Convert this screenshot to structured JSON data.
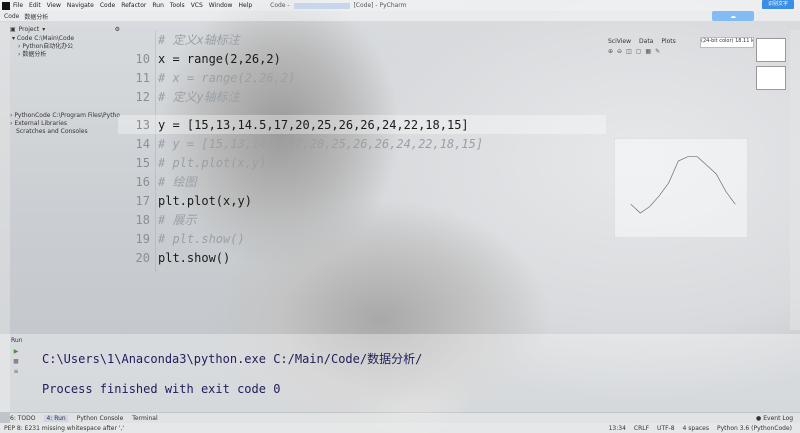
{
  "menu": {
    "items": [
      "File",
      "Edit",
      "View",
      "Navigate",
      "Code",
      "Refactor",
      "Run",
      "Tools",
      "VCS",
      "Window",
      "Help"
    ],
    "title_prefix": "Code -",
    "title_suffix": "[Code] - PyCharm"
  },
  "cloud_button": "识别文字",
  "breadcrumb": [
    "Code",
    "数据分析"
  ],
  "project": {
    "header": "Project",
    "tree": [
      {
        "label": "Code  C:\\Main\\Code"
      },
      {
        "label": "Python自动化办公"
      },
      {
        "label": "数据分析"
      }
    ],
    "tree2": [
      {
        "label": "PythonCode  C:\\Program Files\\Pytho"
      },
      {
        "label": "External Libraries"
      },
      {
        "label": "Scratches and Consoles"
      }
    ]
  },
  "editor": {
    "lines": [
      {
        "n": "",
        "text": "# 定义x轴标注",
        "type": "comment"
      },
      {
        "n": "10",
        "text": "x = range(2,26,2)",
        "type": "code"
      },
      {
        "n": "11",
        "text": "# x = range(2,26,2)",
        "type": "comment"
      },
      {
        "n": "12",
        "text": "# 定义y轴标注",
        "type": "comment"
      },
      {
        "n": "13",
        "text": "y = [15,13,14.5,17,20,25,26,26,24,22,18,15]",
        "type": "code"
      },
      {
        "n": "14",
        "text": "# y = [15,13,14.5,17,20,25,26,26,24,22,18,15]",
        "type": "comment"
      },
      {
        "n": "15",
        "text": "# plt.plot(x,y)",
        "type": "comment"
      },
      {
        "n": "16",
        "text": "# 绘图",
        "type": "comment"
      },
      {
        "n": "17",
        "text": "plt.plot(x,y)",
        "type": "code"
      },
      {
        "n": "18",
        "text": "# 展示",
        "type": "comment"
      },
      {
        "n": "19",
        "text": "# plt.show()",
        "type": "comment"
      },
      {
        "n": "20",
        "text": "plt.show()",
        "type": "code"
      }
    ]
  },
  "sciview": {
    "tabs": [
      "SciView",
      "Data",
      "Plots"
    ],
    "info": "(24-bit color) 18.11 kB",
    "plot": {
      "x": [
        2,
        4,
        6,
        8,
        10,
        12,
        14,
        16,
        18,
        20,
        22,
        24
      ],
      "y": [
        15,
        13,
        14.5,
        17,
        20,
        25,
        26,
        26,
        24,
        22,
        18,
        15
      ]
    }
  },
  "run": {
    "header": "Run",
    "command": "C:\\Users\\1\\Anaconda3\\python.exe C:/Main/Code/数据分析/",
    "result": "Process finished with exit code 0"
  },
  "tool_tabs": [
    "6: TODO",
    "4: Run",
    "Python Console",
    "Terminal"
  ],
  "event_log": "Event Log",
  "status": {
    "message": "PEP 8: E231 missing whitespace after ','",
    "position": "13:34",
    "line_sep": "CRLF",
    "encoding": "UTF-8",
    "indent": "4 spaces",
    "interpreter": "Python 3.6 (PythonCode)"
  }
}
